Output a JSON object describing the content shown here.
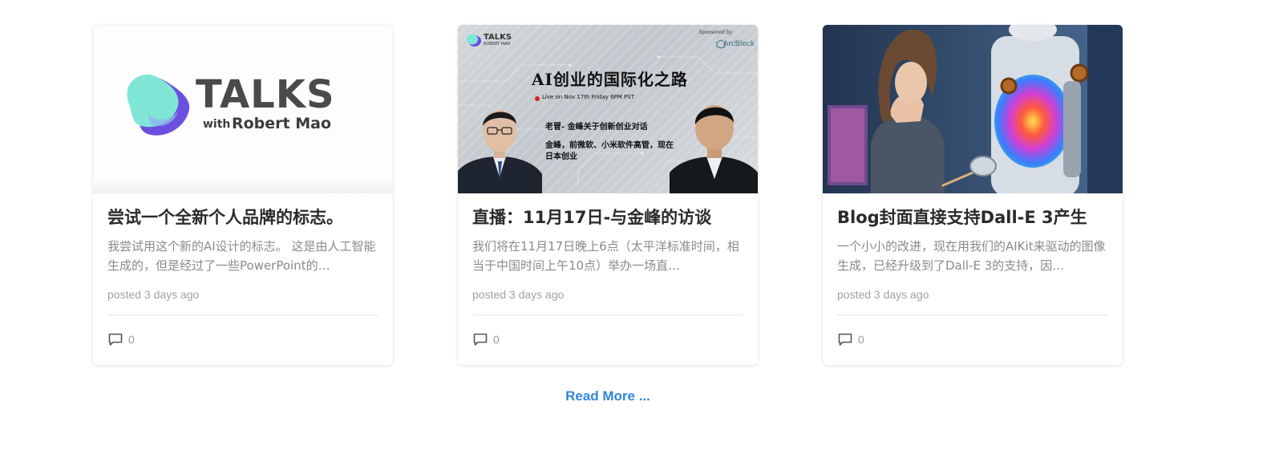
{
  "posts": [
    {
      "title": "尝试一个全新个人品牌的标志。",
      "excerpt": "我尝试用这个新的AI设计的标志。 这是由人工智能生成的，但是经过了一些PowerPoint的…",
      "meta": "posted 3 days ago",
      "comments": "0",
      "cover": {
        "kind": "logo",
        "logo_word": "TALKS",
        "logo_with": "with",
        "logo_name": "Robert Mao"
      }
    },
    {
      "title": "直播：11月17日-与金峰的访谈",
      "excerpt": "我们将在11月17日晚上6点（太平洋标准时间，相当于中国时间上午10点）举办一场直…",
      "meta": "posted 3 days ago",
      "comments": "0",
      "cover": {
        "kind": "event",
        "mini_logo_text": "TALKS",
        "mini_logo_sub": "ROBERT MAO",
        "sponsor_label": "Sponsored by",
        "sponsor_name": "ArcBlock",
        "headline": "AI创业的国际化之路",
        "live_text": "Live on Nov 17th Friday 6PM PST",
        "line1": "老冒- 金峰关于创新创业对话",
        "line2": "金峰，前微软、小米软件高管，现在日本创业"
      }
    },
    {
      "title": "Blog封面直接支持Dall-E 3产生",
      "excerpt": "一个小小的改进，现在用我们的AIKit来驱动的图像生成，已经升级到了Dall-E 3的支持，因…",
      "meta": "posted 3 days ago",
      "comments": "0",
      "cover": {
        "kind": "illustration"
      }
    }
  ],
  "read_more_label": "Read More ...",
  "colors": {
    "link": "#2f86d9",
    "title": "#2b2b2b",
    "excerpt": "#8a8a8a",
    "meta": "#a2a2a2",
    "logo_teal": "#7fe6d6",
    "logo_purple": "#6c4fe0"
  },
  "icons": {
    "comment": "comment-icon"
  }
}
